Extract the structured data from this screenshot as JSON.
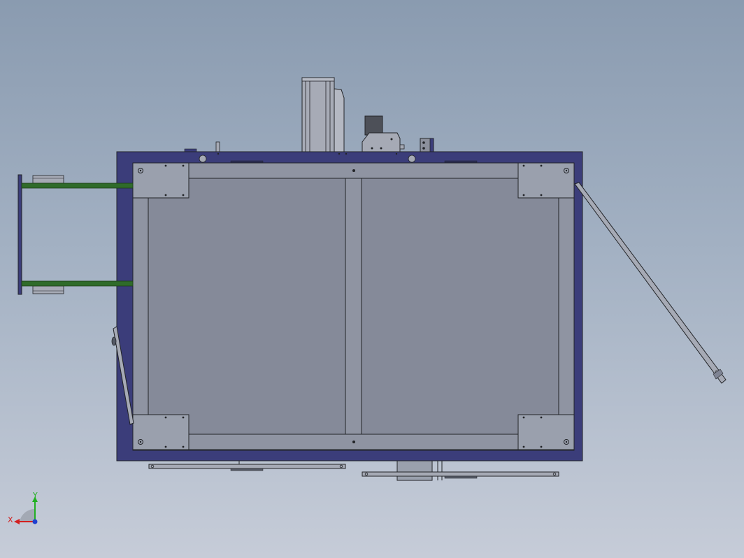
{
  "viewport": {
    "background_top": "#8a9bb0",
    "background_bottom": "#c6ccd8"
  },
  "colors": {
    "frame_outer": "#3b3d7a",
    "frame_inner_plate": "#7f8494",
    "panel": "#9a9fae",
    "corner_plate": "#9aa0ad",
    "green_rod": "#2f6b2a",
    "outline": "#222428"
  },
  "triad": {
    "x_label": "X",
    "y_label": "Y",
    "x_color": "#d22020",
    "y_color": "#22b022",
    "z_color": "#2040d0"
  }
}
